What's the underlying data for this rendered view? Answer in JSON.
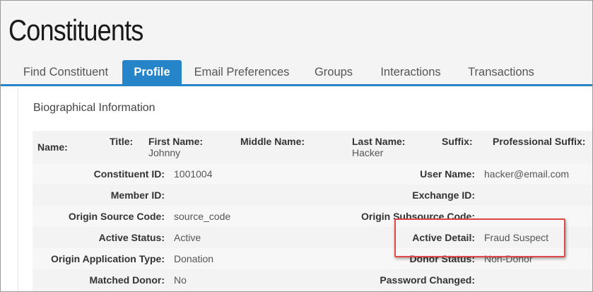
{
  "page": {
    "title": "Constituents"
  },
  "tabs": [
    {
      "label": "Find Constituent",
      "active": false
    },
    {
      "label": "Profile",
      "active": true
    },
    {
      "label": "Email Preferences",
      "active": false
    },
    {
      "label": "Groups",
      "active": false
    },
    {
      "label": "Interactions",
      "active": false
    },
    {
      "label": "Transactions",
      "active": false
    }
  ],
  "section": {
    "title": "Biographical Information"
  },
  "name_row": {
    "name_label": "Name:",
    "title_label": "Title:",
    "first_name_label": "First Name:",
    "first_name_value": "Johnny",
    "middle_name_label": "Middle Name:",
    "last_name_label": "Last Name:",
    "last_name_value": "Hacker",
    "suffix_label": "Suffix:",
    "professional_suffix_label": "Professional Suffix:"
  },
  "fields": {
    "constituent_id": {
      "label": "Constituent ID:",
      "value": "1001004"
    },
    "user_name": {
      "label": "User Name:",
      "value": "hacker@email.com"
    },
    "member_id": {
      "label": "Member ID:",
      "value": ""
    },
    "exchange_id": {
      "label": "Exchange ID:",
      "value": ""
    },
    "origin_source_code": {
      "label": "Origin Source Code:",
      "value": "source_code"
    },
    "origin_subsource_code": {
      "label": "Origin Subsource Code:",
      "value": ""
    },
    "active_status": {
      "label": "Active Status:",
      "value": "Active"
    },
    "active_detail": {
      "label": "Active Detail:",
      "value": "Fraud Suspect"
    },
    "origin_application_type": {
      "label": "Origin Application Type:",
      "value": "Donation"
    },
    "donor_status": {
      "label": "Donor Status:",
      "value": "Non-Donor"
    },
    "matched_donor": {
      "label": "Matched Donor:",
      "value": "No"
    },
    "password_changed": {
      "label": "Password Changed:",
      "value": ""
    }
  },
  "colors": {
    "accent": "#2685c8",
    "highlight": "#e04848"
  }
}
